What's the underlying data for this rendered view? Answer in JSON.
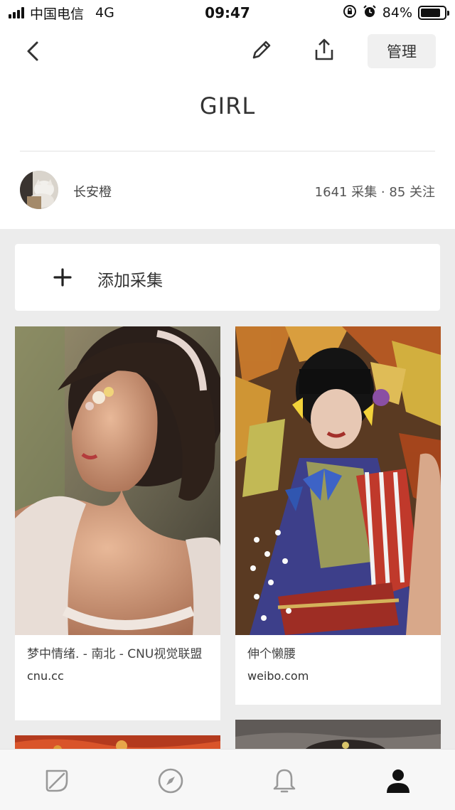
{
  "status_bar": {
    "carrier": "中国电信",
    "network": "4G",
    "time": "09:47",
    "battery_text": "84%",
    "battery_level": 0.84,
    "icons": [
      "signal-icon",
      "orientation-lock-icon",
      "alarm-icon",
      "battery-icon"
    ]
  },
  "nav": {
    "icons": [
      "back-arrow-icon",
      "edit-pencil-icon",
      "share-upload-icon"
    ],
    "manage_label": "管理"
  },
  "board": {
    "title": "GIRL",
    "owner": "长安橙",
    "stats": "1641 采集 · 85 关注"
  },
  "add_collect": {
    "icon": "plus-icon",
    "label": "添加采集"
  },
  "pins": [
    {
      "title": "梦中情绪. - 南北 - CNU视觉联盟",
      "source": "cnu.cc"
    },
    {
      "title": "伸个懒腰",
      "source": "weibo.com"
    }
  ],
  "tabbar": {
    "icons": [
      "leaf-home-icon",
      "compass-explore-icon",
      "bell-notification-icon",
      "person-profile-icon"
    ],
    "active": "person-profile-icon"
  },
  "colors": {
    "background": "#ececec",
    "card": "#ffffff",
    "text": "#333333",
    "muted": "#555555",
    "tab_inactive": "#999999",
    "tab_active": "#111111"
  }
}
